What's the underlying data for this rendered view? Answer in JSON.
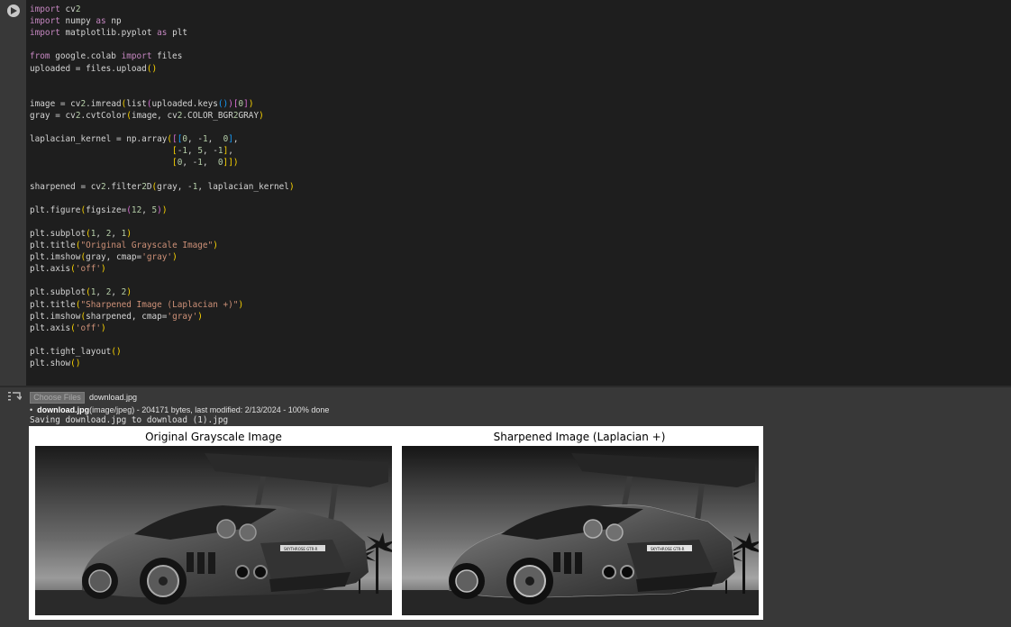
{
  "notebook": {
    "run_button": "run-cell",
    "output_icon": "output-toggle-icon"
  },
  "code_lines": [
    "import cv2",
    "import numpy as np",
    "import matplotlib.pyplot as plt",
    "",
    "from google.colab import files",
    "uploaded = files.upload()",
    "",
    "",
    "image = cv2.imread(list(uploaded.keys())[0])",
    "gray = cv2.cvtColor(image, cv2.COLOR_BGR2GRAY)",
    "",
    "laplacian_kernel = np.array([[0, -1,  0],",
    "                            [-1, 5, -1],",
    "                            [0, -1,  0]])",
    "",
    "sharpened = cv2.filter2D(gray, -1, laplacian_kernel)",
    "",
    "plt.figure(figsize=(12, 5))",
    "",
    "plt.subplot(1, 2, 1)",
    "plt.title(\"Original Grayscale Image\")",
    "plt.imshow(gray, cmap='gray')",
    "plt.axis('off')",
    "",
    "plt.subplot(1, 2, 2)",
    "plt.title(\"Sharpened Image (Laplacian +)\")",
    "plt.imshow(sharpened, cmap='gray')",
    "plt.axis('off')",
    "",
    "plt.tight_layout()",
    "plt.show()"
  ],
  "output": {
    "choose_files_label": "Choose Files",
    "file_name": "download.jpg",
    "upload_bullet": "•",
    "upload_file": "download.jpg",
    "upload_detail": "(image/jpeg) - 204171 bytes, last modified: 2/13/2024 - 100% done",
    "saving_text": "Saving download.jpg to download (1).jpg"
  },
  "figure": {
    "left_title": "Original Grayscale Image",
    "right_title": "Sharpened Image (Laplacian +)",
    "plate_text": "SKYTHROSE GTR-R"
  }
}
